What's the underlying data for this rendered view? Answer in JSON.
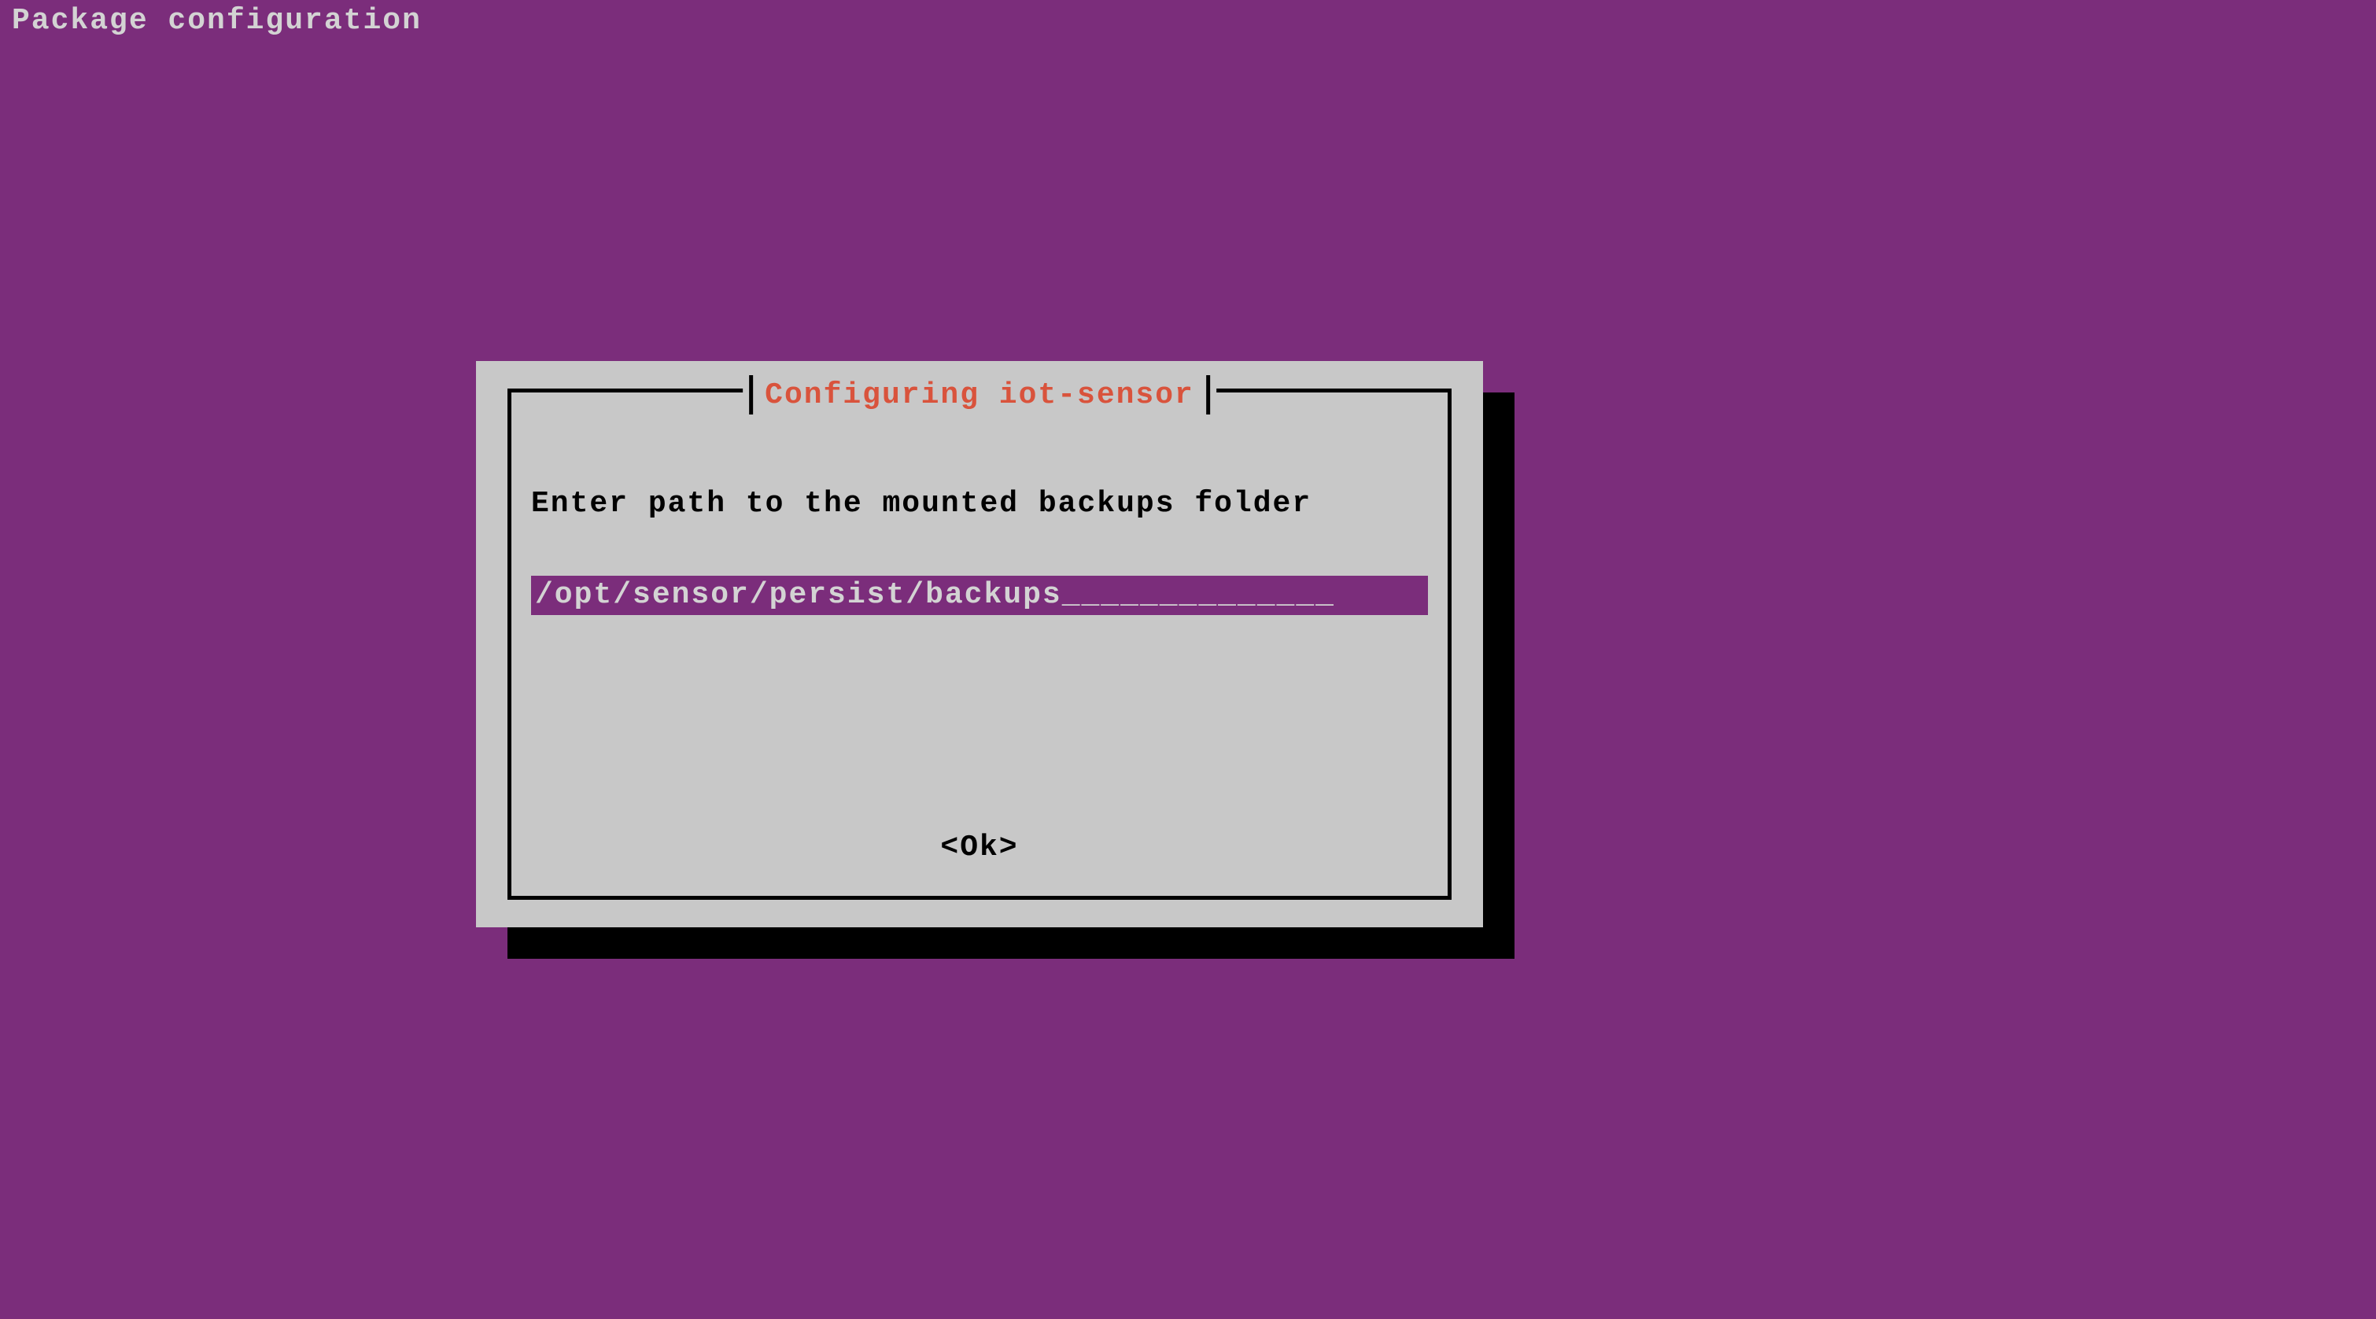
{
  "header": {
    "title": "Package configuration"
  },
  "dialog": {
    "title": "Configuring iot-sensor",
    "prompt": "Enter path to the mounted backups folder",
    "input_value": "/opt/sensor/persist/backups______________",
    "ok_label": "<Ok>"
  }
}
